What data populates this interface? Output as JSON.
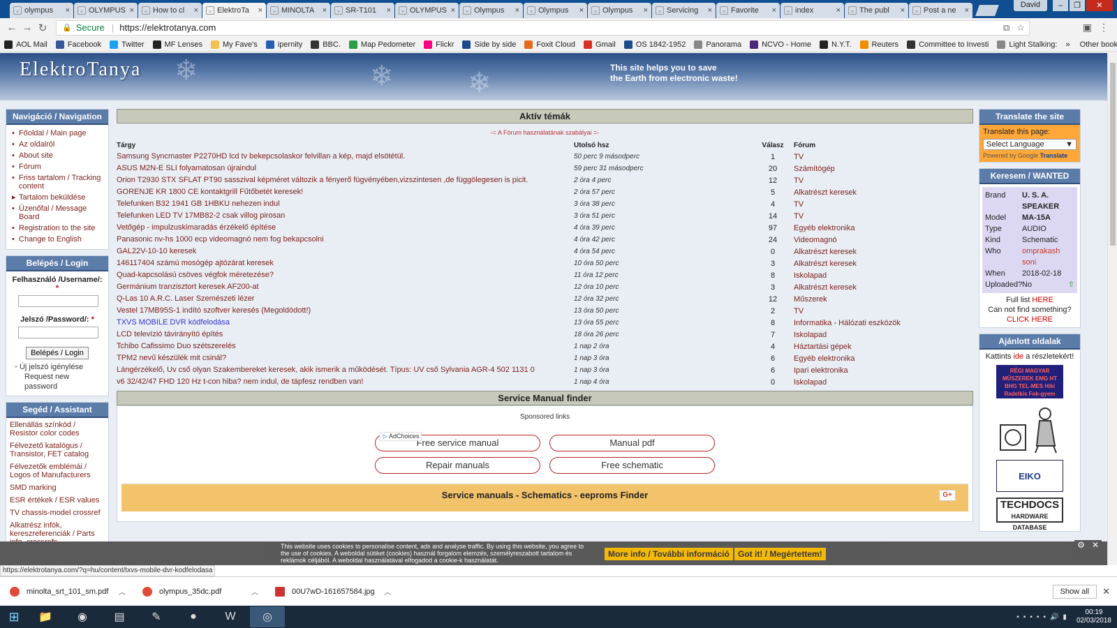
{
  "browser": {
    "tabs": [
      {
        "icon": "google-icon",
        "label": "olympus"
      },
      {
        "icon": "page-icon",
        "label": "OLYMPUS"
      },
      {
        "icon": "page-icon",
        "label": "How to cl"
      },
      {
        "icon": "page-icon",
        "label": "ElektroTa"
      },
      {
        "icon": "page-icon",
        "label": "MINOLTA"
      },
      {
        "icon": "page-icon",
        "label": "SR-T101"
      },
      {
        "icon": "page-icon",
        "label": "OLYMPUS"
      },
      {
        "icon": "page-icon",
        "label": "Olympus"
      },
      {
        "icon": "page-icon",
        "label": "Olympus"
      },
      {
        "icon": "flickr-icon",
        "label": "Olympus"
      },
      {
        "icon": "page-icon",
        "label": "Servicing"
      },
      {
        "icon": "page-icon",
        "label": "Favorite"
      },
      {
        "icon": "page-icon",
        "label": "index"
      },
      {
        "icon": "c-icon",
        "label": "The publ"
      },
      {
        "icon": "mf-icon",
        "label": "Post a ne"
      }
    ],
    "active_tab_index": 3,
    "user": "David",
    "secure_label": "Secure",
    "url": "https://elektrotanya.com",
    "bookmarks": [
      {
        "label": "AOL Mail",
        "color": "#222222"
      },
      {
        "label": "Facebook",
        "color": "#3b5998"
      },
      {
        "label": "Twitter",
        "color": "#1da1f2"
      },
      {
        "label": "MF Lenses",
        "color": "#222222"
      },
      {
        "label": "My Fave's",
        "color": "#f2c14e"
      },
      {
        "label": "ipernity",
        "color": "#2a5db0"
      },
      {
        "label": "BBC.",
        "color": "#333333"
      },
      {
        "label": "Map Pedometer",
        "color": "#2e9d47"
      },
      {
        "label": "Flickr",
        "color": "#ff0084"
      },
      {
        "label": "Side by side",
        "color": "#1c4a8a"
      },
      {
        "label": "Foxit Cloud",
        "color": "#e36b1e"
      },
      {
        "label": "Gmail",
        "color": "#d93025"
      },
      {
        "label": "OS 1842-1952",
        "color": "#1c4a8a"
      },
      {
        "label": "Panorama",
        "color": "#888888"
      },
      {
        "label": "NCVO - Home",
        "color": "#4b2a7a"
      },
      {
        "label": "N.Y.T.",
        "color": "#222222"
      },
      {
        "label": "Reuters",
        "color": "#f28c00"
      },
      {
        "label": "Committee to Investi",
        "color": "#333333"
      },
      {
        "label": "Light Stalking:",
        "color": "#888888"
      }
    ],
    "other_bookmarks": "Other bookmarks",
    "status_url": "https://elektrotanya.com/?q=hu/content/txvs-mobile-dvr-kodfelodasa"
  },
  "site": {
    "logo": "ElektroTanya",
    "slogan_line1": "This site helps you to save",
    "slogan_line2": "the Earth from electronic waste!"
  },
  "nav": {
    "title": "Navigáció / Navigation",
    "items": [
      "Főoldal / Main page",
      "Az oldalról",
      "About site",
      "Fórum",
      "Friss tartalom / Tracking content",
      "Tartalom beküldése",
      "Üzenőfal / Message Board",
      "Registration to the site",
      "Change to English"
    ]
  },
  "login": {
    "title": "Belépés / Login",
    "username_label": "Felhasználó /Username/:",
    "password_label": "Jelszó /Password/:",
    "required_mark": "*",
    "button": "Belépés / Login",
    "new_password_hu": "Új jelszó igénylése",
    "new_password_en": "Request new password"
  },
  "assistant": {
    "title": "Segéd / Assistant",
    "items": [
      "Ellenállás színkód / Resistor color codes",
      "Félvezető katalógus / Transistor, FET catalog",
      "Félvezetők emblémái / Logos of Manufacturers",
      "SMD marking",
      "ESR értékek / ESR values",
      "TV chassis-model crossref",
      "Alkatrész infók, kereszreferenciák / Parts info, crossrefs"
    ]
  },
  "topics": {
    "title": "Aktív témák",
    "rules_link": "-= A Fórum használatának szabályai =-",
    "headers": {
      "subject": "Tárgy",
      "last": "Utolsó hsz",
      "replies": "Válasz",
      "forum": "Fórum"
    },
    "rows": [
      {
        "subject": "Samsung Syncmaster P2270HD lcd tv bekepcsolaskor felvillan a kép, majd elsötétül.",
        "last": "50 perc 9 másodperc",
        "replies": "1",
        "forum": "TV"
      },
      {
        "subject": "ASUS M2N-E SLI folyamatosan újraindul",
        "last": "59 perc 31 másodperc",
        "replies": "20",
        "forum": "Számítógép"
      },
      {
        "subject": "Orion T2930 STX SFLAT PT90 sasszival képméret változik a fényerő fügvényében,vizszintesen ,de függölegesen is picit.",
        "last": "2 óra 4 perc",
        "replies": "12",
        "forum": "TV"
      },
      {
        "subject": "GORENJE KR 1800 CE kontaktgrill Fűtőbetét keresek!",
        "last": "2 óra 57 perc",
        "replies": "5",
        "forum": "Alkatrészt keresek"
      },
      {
        "subject": "Telefunken B32 1941 GB 1HBKU nehezen indul",
        "last": "3 óra 38 perc",
        "replies": "4",
        "forum": "TV"
      },
      {
        "subject": "Telefunken LED TV 17MB82-2 csak villog pirosan",
        "last": "3 óra 51 perc",
        "replies": "14",
        "forum": "TV"
      },
      {
        "subject": "Vetőgép - impulzuskimaradás érzékelő építése",
        "last": "4 óra 39 perc",
        "replies": "97",
        "forum": "Egyéb elektronika"
      },
      {
        "subject": "Panasonic nv-hs 1000 ecp videomagnó nem fog bekapcsolni",
        "last": "4 óra 42 perc",
        "replies": "24",
        "forum": "Videomagnó"
      },
      {
        "subject": "GAL22V-10-10 keresek",
        "last": "4 óra 54 perc",
        "replies": "0",
        "forum": "Alkatrészt keresek"
      },
      {
        "subject": "146117404 számú mosógép ajtózárat keresek",
        "last": "10 óra 50 perc",
        "replies": "3",
        "forum": "Alkatrészt keresek"
      },
      {
        "subject": "Quad-kapcsolású csöves végfok méretezése?",
        "last": "11 óra 12 perc",
        "replies": "8",
        "forum": "Iskolapad"
      },
      {
        "subject": "Germánium tranzisztort keresek AF200-at",
        "last": "12 óra 10 perc",
        "replies": "3",
        "forum": "Alkatrészt keresek"
      },
      {
        "subject": "Q-Las 10 A.R.C. Laser Szemészeti lézer",
        "last": "12 óra 32 perc",
        "replies": "12",
        "forum": "Műszerek"
      },
      {
        "subject": "Vestel 17MB95S-1 indító szoftver keresés (Megoldódott!)",
        "last": "13 óra 50 perc",
        "replies": "2",
        "forum": "TV"
      },
      {
        "subject": "TXVS MOBILE DVR kódfelodása",
        "last": "13 óra 55 perc",
        "replies": "8",
        "forum": "Informatika - Hálózati eszközök",
        "visited": true
      },
      {
        "subject": "LCD televízió távirányító építés",
        "last": "18 óra 26 perc",
        "replies": "7",
        "forum": "Iskolapad"
      },
      {
        "subject": "Tchibo Cafissimo Duo szétszerelés",
        "last": "1 nap 2 óra",
        "replies": "4",
        "forum": "Háztartási gépek"
      },
      {
        "subject": "TPM2 nevű készülék mit csinál?",
        "last": "1 nap 3 óra",
        "replies": "6",
        "forum": "Egyéb elektronika"
      },
      {
        "subject": "Lángérzékelő, Uv cső olyan Szakembereket keresek, akik ismerik a működését. Típus: UV cső Sylvania AGR-4 502 1131 0",
        "last": "1 nap 3 óra",
        "replies": "6",
        "forum": "Ipari elektronika"
      },
      {
        "subject": "v6 32/42/47 FHD 120 Hz t-con hiba? nem indul, de tápfesz rendben van!",
        "last": "1 nap 4 óra",
        "replies": "0",
        "forum": "Iskolapad"
      }
    ]
  },
  "manual_finder": {
    "title": "Service Manual finder",
    "sponsored": "Sponsored links",
    "adchoices": "AdChoices",
    "buttons": [
      "Free service manual",
      "Manual pdf",
      "Repair manuals",
      "Free schematic"
    ],
    "finder_title": "Service manuals - Schematics - eeproms Finder",
    "gplus": "G+"
  },
  "right": {
    "translate_title": "Translate the site",
    "translate_page": "Translate this page:",
    "select_language": "Select Language",
    "powered_by": "Powered by",
    "google": "Google",
    "translate_word": "Translate",
    "wanted_title": "Keresem / WANTED",
    "wanted": [
      {
        "key": "Brand",
        "value": "U. S. A. SPEAKER",
        "style": "bold"
      },
      {
        "key": "Model",
        "value": "MA-15A",
        "style": "bold"
      },
      {
        "key": "Type",
        "value": "AUDIO",
        "style": ""
      },
      {
        "key": "Kind",
        "value": "Schematic",
        "style": ""
      },
      {
        "key": "Who",
        "value": "omprakash soni",
        "style": "link"
      },
      {
        "key": "When",
        "value": "2018-02-18",
        "style": ""
      },
      {
        "key": "Uploaded?",
        "value": "No",
        "style": ""
      }
    ],
    "full_list": "Full list",
    "here": "HERE",
    "cannot_find": "Can not find something?",
    "click_here": "CLICK HERE",
    "ajanlott_title": "Ajánlott oldalak",
    "kattints_pre": "Kattints",
    "kattints_ide": "ide",
    "kattints_post": "a részletekért!",
    "ad1_text": "RÉGI MAGYAR MŰSZEREK EMG HT BHG TEL-MES Hiki Radelkis Fok-gyem",
    "ad3_text": "EIKO",
    "ad4_title": "TECHDOCS",
    "ad4_sub": "HARDWARE DATABASE"
  },
  "cookie": {
    "text": "This website uses cookies to personalise content, ads and analyse traffic. By using this website, you agree to the use of cookies. A weboldal sütiket (cookies) használ forgalom elemzés, személyreszabott tartalom és reklámok céljából. A weboldal használatával elfogadod a cookie-k használatát.",
    "more_info": "More info / További információ",
    "got_it": "Got it! / Megértettem!"
  },
  "downloads": {
    "items": [
      {
        "label": "minolta_srt_101_sm.pdf",
        "icon": "chrome-pdf-icon"
      },
      {
        "label": "olympus_35dc.pdf",
        "icon": "chrome-pdf-icon"
      },
      {
        "label": "00U7wD-161657584.jpg",
        "icon": "image-file-icon"
      }
    ],
    "show_all": "Show all"
  },
  "taskbar": {
    "time": "00:19",
    "date": "02/03/2018"
  }
}
